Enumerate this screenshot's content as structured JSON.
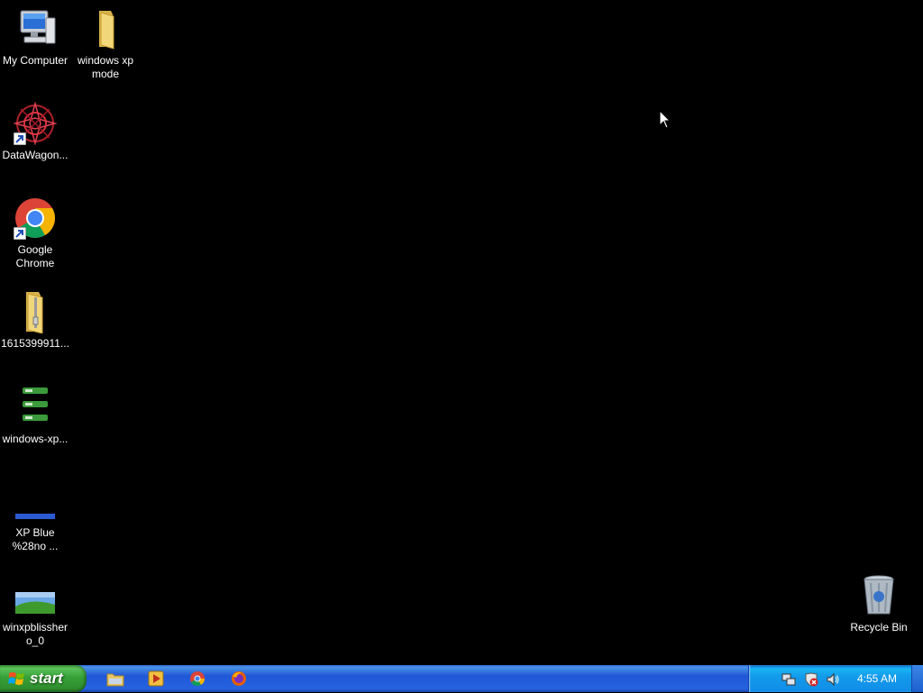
{
  "desktop": {
    "icons": [
      {
        "label": "My Computer",
        "icon": "my-computer-icon"
      },
      {
        "label": "windows xp mode",
        "icon": "folder-icon"
      },
      {
        "label": "DataWagon...",
        "icon": "datawagon-icon"
      },
      {
        "label": "Google Chrome",
        "icon": "chrome-icon"
      },
      {
        "label": "1615399911...",
        "icon": "zip-folder-icon"
      },
      {
        "label": "windows-xp...",
        "icon": "image-thumbnail-icon"
      },
      {
        "label": "XP Blue %28no ...",
        "icon": "image-thumbnail-icon"
      },
      {
        "label": "winxpblissher o_0",
        "icon": "image-thumbnail-icon"
      },
      {
        "label": "Recycle Bin",
        "icon": "recycle-bin-icon"
      }
    ]
  },
  "taskbar": {
    "start_label": "start",
    "quick_launch": [
      {
        "icon": "explorer-folder-icon"
      },
      {
        "icon": "media-player-icon"
      },
      {
        "icon": "chrome-icon"
      },
      {
        "icon": "firefox-icon"
      }
    ],
    "tray": {
      "icons": [
        "network-icon",
        "security-alert-icon",
        "volume-icon"
      ],
      "clock": "4:55 AM"
    }
  },
  "colors": {
    "desktop_bg": "#000000",
    "taskbar_blue": "#245edb",
    "start_green": "#37a137",
    "tray_blue": "#139beb"
  }
}
